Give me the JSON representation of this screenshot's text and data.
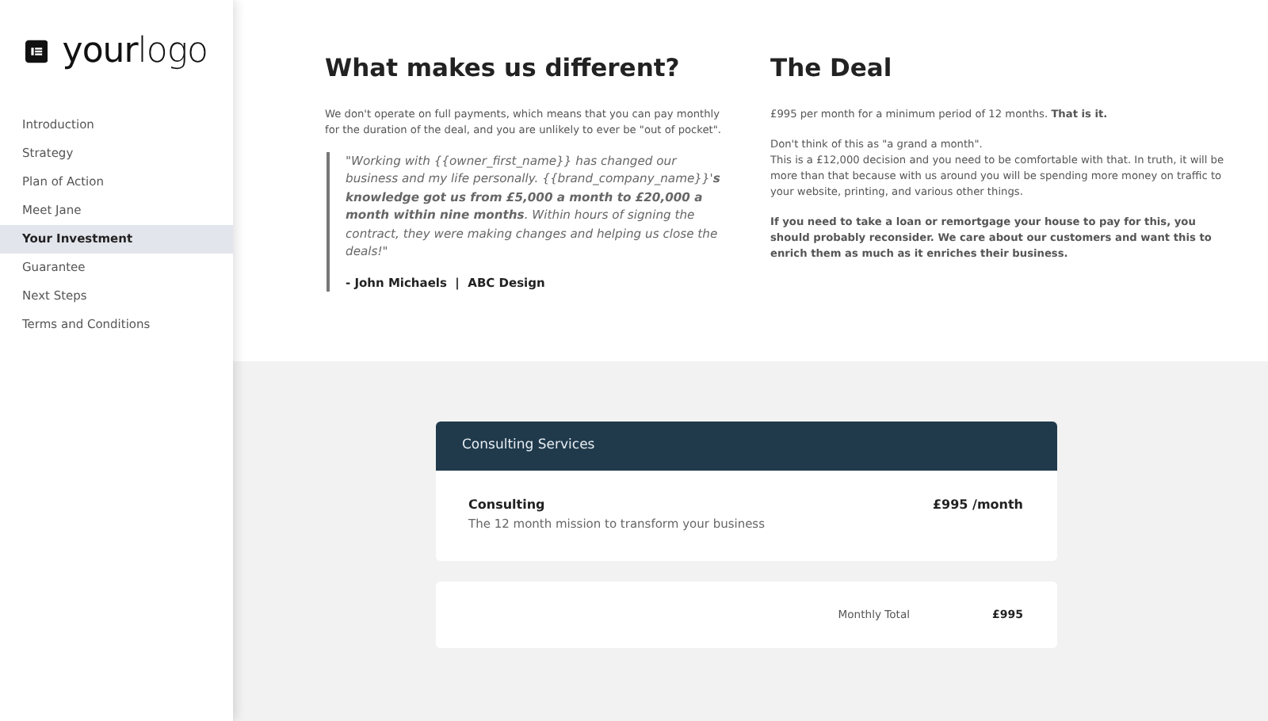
{
  "logo": {
    "text": "**your**logo"
  },
  "sidebar": {
    "items": [
      {
        "label": "Introduction",
        "selected": false
      },
      {
        "label": "Strategy",
        "selected": false
      },
      {
        "label": "Plan of Action",
        "selected": false
      },
      {
        "label": "Meet Jane",
        "selected": false
      },
      {
        "label": "Your Investment",
        "selected": true
      },
      {
        "label": "Guarantee",
        "selected": false
      },
      {
        "label": "Next Steps",
        "selected": false
      },
      {
        "label": "Terms and Conditions",
        "selected": false
      }
    ]
  },
  "different": {
    "title": "What makes us different?",
    "text": "We don't operate on full payments, which means that you can pay monthly for the duration of the deal, and you are unlikely to ever be \"out of pocket\".",
    "quote": "\"Working with {{owner_first_name}} has changed our business and my life personally. {{brand_company_name}}'**s knowledge got us from £5,000 a month to £20,000 a month within nine months**. Within hours of signing the contract, they were making changes and helping us close the deals!\"",
    "author": "- John Michaels  |  ABC Design"
  },
  "deal": {
    "title": "The Deal",
    "paragraphs": [
      "£995 per month for a minimum period of 12 months. **That is it.**",
      "Don't think of this as \"a grand a month\".\nThis is a £12,000 decision and you need to be comfortable with that. In truth, it will be more than that because with us around you will be spending more money on traffic to your website, printing, and various other things.",
      "**If you need to take a loan or remortgage your house to pay for this, you should probably reconsider. We care about our customers and want this to enrich them as much as it enriches their business.**"
    ]
  },
  "pricing": {
    "header": "Consulting Services",
    "items": [
      {
        "name": "Consulting",
        "description": "The 12 month mission to transform your business",
        "price": "£995 /month"
      }
    ],
    "total_label": "Monthly Total",
    "total": "£995"
  }
}
